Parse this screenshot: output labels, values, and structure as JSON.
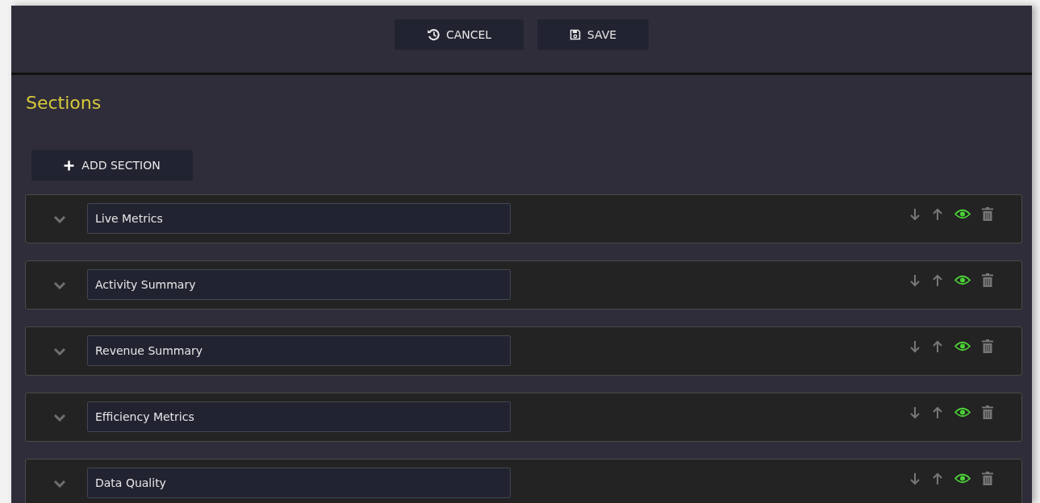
{
  "toolbar": {
    "buttons": [
      {
        "kind": "cancel",
        "label": "CANCEL"
      },
      {
        "kind": "save",
        "label": "SAVE"
      }
    ]
  },
  "heading": "Sections",
  "add_button": "ADD SECTION",
  "sections": [
    {
      "name": "Live Metrics",
      "visible": true
    },
    {
      "name": "Activity Summary",
      "visible": true
    },
    {
      "name": "Revenue Summary",
      "visible": true
    },
    {
      "name": "Efficiency Metrics",
      "visible": true
    },
    {
      "name": "Data Quality",
      "visible": true
    }
  ]
}
